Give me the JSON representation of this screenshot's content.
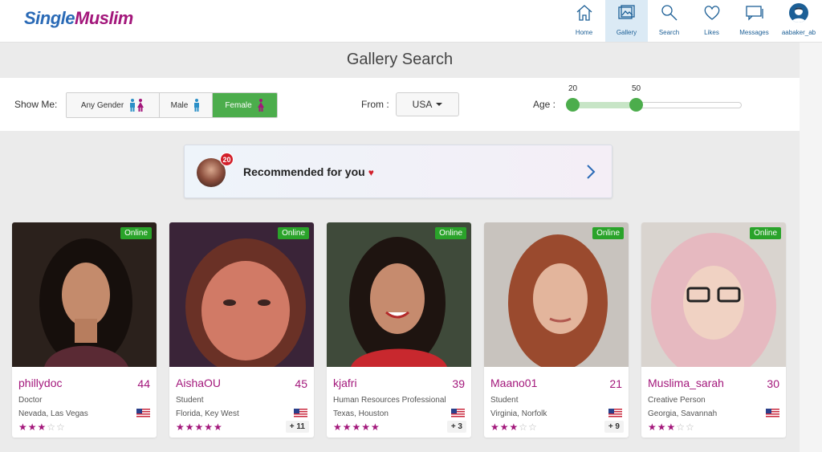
{
  "brand": {
    "part1": "Single",
    "part2": "Muslim"
  },
  "nav": {
    "items": [
      {
        "label": "Home",
        "icon": "home-icon"
      },
      {
        "label": "Gallery",
        "icon": "gallery-icon",
        "active": true
      },
      {
        "label": "Search",
        "icon": "search-icon"
      },
      {
        "label": "Likes",
        "icon": "heart-icon"
      },
      {
        "label": "Messages",
        "icon": "messages-icon"
      },
      {
        "label": "aabaker_ab",
        "icon": "user-avatar-icon"
      }
    ]
  },
  "page": {
    "title": "Gallery Search"
  },
  "filters": {
    "show_me_label": "Show Me:",
    "genders": [
      {
        "label": "Any Gender",
        "selected": false
      },
      {
        "label": "Male",
        "selected": false
      },
      {
        "label": "Female",
        "selected": true
      }
    ],
    "from_label": "From :",
    "country": "USA",
    "age_label": "Age :",
    "age_min": "20",
    "age_max": "50"
  },
  "recommended": {
    "text": "Recommended for you",
    "count": "20"
  },
  "colors": {
    "brand_blue": "#2a6ab6",
    "brand_magenta": "#a3177b",
    "online_green": "#2aa32a",
    "accent_green": "#4cad4c"
  },
  "profiles": [
    {
      "username": "phillydoc",
      "age": "44",
      "occupation": "Doctor",
      "location": "Nevada, Las Vegas",
      "status": "Online",
      "extra_photos": "",
      "rating": 3
    },
    {
      "username": "AishaOU",
      "age": "45",
      "occupation": "Student",
      "location": "Florida, Key West",
      "status": "Online",
      "extra_photos": "+ 11",
      "rating": 5
    },
    {
      "username": "kjafri",
      "age": "39",
      "occupation": "Human Resources Professional",
      "location": "Texas, Houston",
      "status": "Online",
      "extra_photos": "+ 3",
      "rating": 5
    },
    {
      "username": "Maano01",
      "age": "21",
      "occupation": "Student",
      "location": "Virginia, Norfolk",
      "status": "Online",
      "extra_photos": "+ 9",
      "rating": 3
    },
    {
      "username": "Muslima_sarah",
      "age": "30",
      "occupation": "Creative Person",
      "location": "Georgia, Savannah",
      "status": "Online",
      "extra_photos": "",
      "rating": 3
    }
  ]
}
